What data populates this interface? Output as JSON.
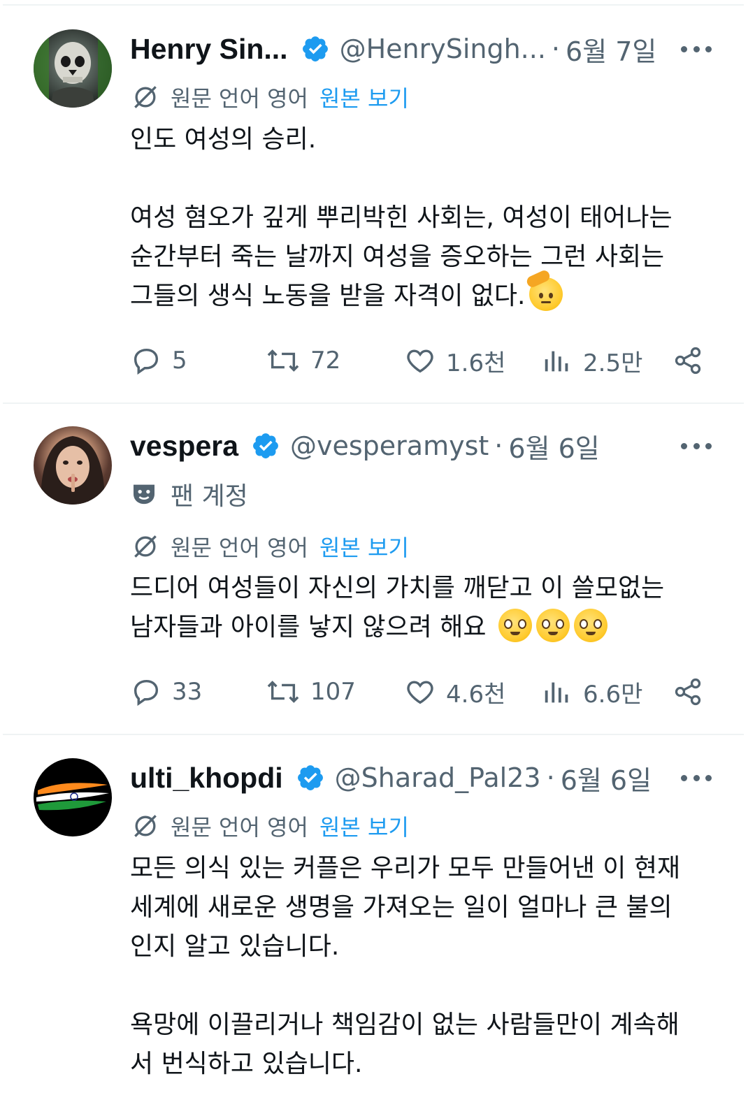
{
  "colors": {
    "accent": "#1d9bf0",
    "muted": "#536471",
    "text": "#0f1419",
    "divider": "#eff3f4"
  },
  "tweets": [
    {
      "name": "Henry Sin...",
      "handle": "@HenrySingh...",
      "date": "6월 7일",
      "translate": {
        "label": "원문 언어 영어",
        "link": "원본 보기"
      },
      "text": "인도 여성의 승리.\n\n여성 혐오가 깊게 뿌리박힌 사회는, 여성이 태어나는\n순간부터 죽는 날까지 여성을 증오하는 그런 사회는\n그들의 생식 노동을 받을 자격이 없다.",
      "emoji": [
        "saluting-face"
      ],
      "stats": {
        "replies": "5",
        "reposts": "72",
        "likes": "1.6천",
        "views": "2.5만"
      }
    },
    {
      "name": "vespera",
      "handle": "@vesperamyst",
      "date": "6월 6일",
      "badge": "팬 계정",
      "translate": {
        "label": "원문 언어 영어",
        "link": "원본 보기"
      },
      "text": "드디어 여성들이 자신의 가치를 깨닫고 이 쓸모없는\n남자들과 아이를 낳지 않으려 해요",
      "emoji": [
        "pleading-face",
        "pleading-face",
        "pleading-face"
      ],
      "stats": {
        "replies": "33",
        "reposts": "107",
        "likes": "4.6천",
        "views": "6.6만"
      }
    },
    {
      "name": "ulti_khopdi",
      "handle": "@Sharad_Pal23",
      "date": "6월 6일",
      "translate": {
        "label": "원문 언어 영어",
        "link": "원본 보기"
      },
      "text": "모든 의식 있는 커플은 우리가 모두 만들어낸 이 현재\n세계에 새로운 생명을 가져오는 일이 얼마나 큰 불의\n인지 알고 있습니다.\n\n욕망에 이끌리거나 책임감이 없는 사람들만이 계속해\n서 번식하고 있습니다."
    }
  ],
  "separator": "·"
}
